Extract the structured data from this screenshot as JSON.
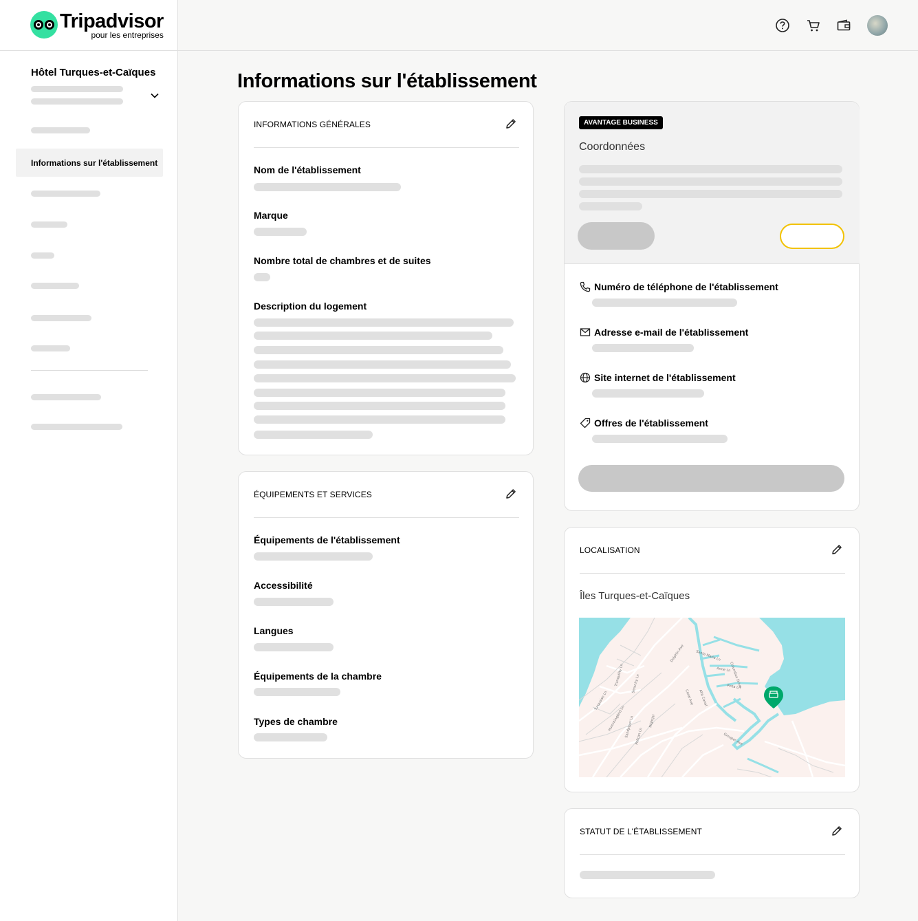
{
  "brand": {
    "name": "Tripadvisor",
    "subtitle": "pour les entreprises"
  },
  "sidebar": {
    "hotel_name": "Hôtel Turques-et-Caïques",
    "active_item": "Informations sur l'établissement"
  },
  "topbar": {
    "icons": [
      "help-icon",
      "cart-icon",
      "wallet-icon"
    ]
  },
  "page": {
    "title": "Informations sur l'établissement"
  },
  "general_info": {
    "heading": "INFORMATIONS GÉNÉRALES",
    "fields": [
      "Nom de l'établissement",
      "Marque",
      "Nombre total de chambres et de suites",
      "Description du logement"
    ]
  },
  "amenities": {
    "heading": "ÉQUIPEMENTS ET SERVICES",
    "fields": [
      "Équipements de l'établissement",
      "Accessibilité",
      "Langues",
      "Équipements de la chambre",
      "Types de chambre"
    ]
  },
  "business": {
    "badge": "AVANTAGE BUSINESS",
    "title": "Coordonnées",
    "contacts": [
      "Numéro de téléphone de l'établissement",
      "Adresse e-mail de l'établissement",
      "Site internet de l'établissement",
      "Offres de l'établissement"
    ]
  },
  "location": {
    "heading": "LOCALISATION",
    "place": "Îles Turques-et-Caïques"
  },
  "status": {
    "heading": "STATUT DE L'ÉTABLISSEMENT"
  },
  "colors": {
    "brand_green": "#34e0a1",
    "map_water": "#96e0e6",
    "map_land": "#fbf1ee",
    "pin": "#00a86b",
    "accent_yellow": "#f2c200"
  }
}
